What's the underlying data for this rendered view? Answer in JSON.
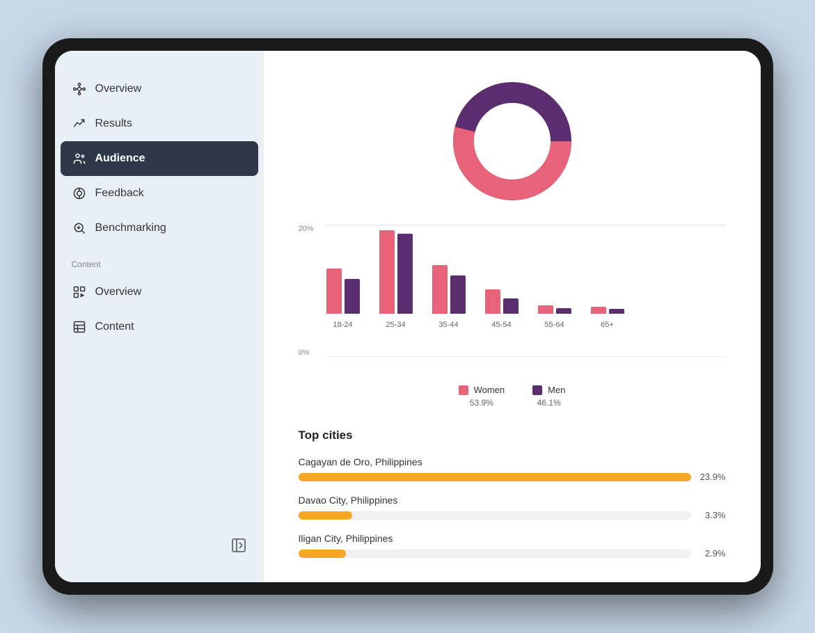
{
  "sidebar": {
    "nav_items": [
      {
        "id": "overview",
        "label": "Overview",
        "icon": "hub",
        "active": false
      },
      {
        "id": "results",
        "label": "Results",
        "icon": "trending",
        "active": false
      },
      {
        "id": "audience",
        "label": "Audience",
        "icon": "people",
        "active": true
      },
      {
        "id": "feedback",
        "label": "Feedback",
        "icon": "chat",
        "active": false
      },
      {
        "id": "benchmarking",
        "label": "Benchmarking",
        "icon": "search-chart",
        "active": false
      }
    ],
    "content_label": "Content",
    "content_items": [
      {
        "id": "content-overview",
        "label": "Overview",
        "icon": "grid-play",
        "active": false
      },
      {
        "id": "content",
        "label": "Content",
        "icon": "table",
        "active": false
      }
    ],
    "collapse_icon": "sidebar-collapse"
  },
  "donut": {
    "women_pct": 53.9,
    "men_pct": 46.1,
    "women_color": "#e8637a",
    "men_color": "#5a2d6e"
  },
  "bar_chart": {
    "y_labels": [
      "20%",
      "0%"
    ],
    "groups": [
      {
        "label": "18-24",
        "women_h": 65,
        "men_h": 50
      },
      {
        "label": "25-34",
        "women_h": 120,
        "men_h": 115
      },
      {
        "label": "35-44",
        "women_h": 70,
        "men_h": 55
      },
      {
        "label": "45-54",
        "women_h": 35,
        "men_h": 22
      },
      {
        "label": "55-64",
        "women_h": 12,
        "men_h": 8
      },
      {
        "label": "65+",
        "women_h": 10,
        "men_h": 7
      }
    ],
    "legend": [
      {
        "label": "Women",
        "pct": "53.9%",
        "color": "#e8637a"
      },
      {
        "label": "Men",
        "pct": "46.1%",
        "color": "#5a2d6e"
      }
    ]
  },
  "top_cities": {
    "title": "Top cities",
    "cities": [
      {
        "name": "Cagayan de Oro, Philippines",
        "pct": "23.9%",
        "pct_num": 23.9,
        "max": 23.9
      },
      {
        "name": "Davao City, Philippines",
        "pct": "3.3%",
        "pct_num": 3.3,
        "max": 23.9
      },
      {
        "name": "Iligan City, Philippines",
        "pct": "2.9%",
        "pct_num": 2.9,
        "max": 23.9
      }
    ]
  }
}
